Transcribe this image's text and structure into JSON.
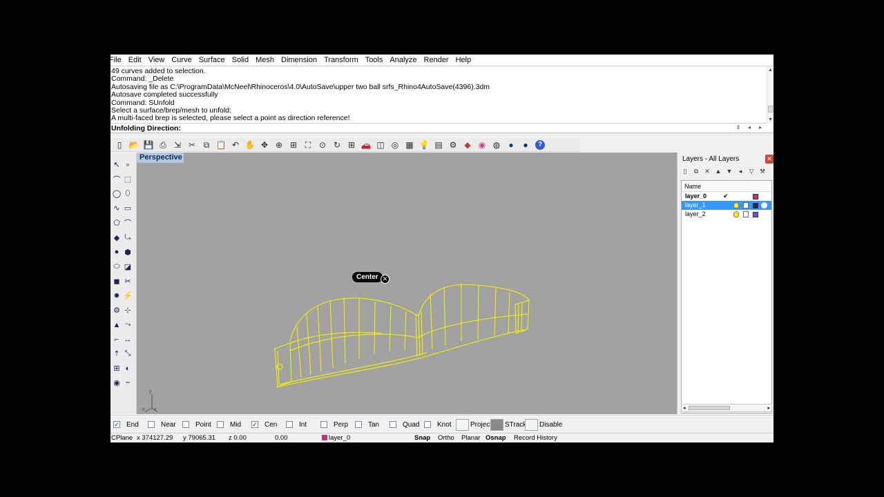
{
  "menu": [
    "File",
    "Edit",
    "View",
    "Curve",
    "Surface",
    "Solid",
    "Mesh",
    "Dimension",
    "Transform",
    "Tools",
    "Analyze",
    "Render",
    "Help"
  ],
  "command_history": [
    "49 curves added to selection.",
    "Command: _Delete",
    "Autosaving file as C:\\ProgramData\\McNeel\\Rhinoceros\\4.0\\AutoSave\\upper  two ball srfs_Rhino4AutoSave(4396).3dm",
    "Autosave completed successfully",
    "Command: SUnfold",
    "Select a surface/brep/mesh to unfold:",
    "A multi-faced brep is selected, please select a point as direction reference!"
  ],
  "command_prompt": "Unfolding Direction:",
  "viewport": {
    "title": "Perspective",
    "snap_tooltip": "Center",
    "background": "#a2a2a2",
    "wire_color": "#f2f200"
  },
  "toolbar_icons": [
    "new-file-icon",
    "open-icon",
    "save-icon",
    "print-icon",
    "import-icon",
    "cut-icon",
    "copy-icon",
    "paste-icon",
    "undo-icon",
    "pan-icon",
    "move-icon",
    "zoom-icon",
    "zoom-window-icon",
    "zoom-extents-icon",
    "zoom-selected-icon",
    "rotate-view-icon",
    "four-views-icon",
    "car-icon",
    "cplane-icon",
    "object-snap-icon",
    "grid-icon",
    "lightbulb-icon",
    "layer-icon",
    "properties-icon",
    "render-icon",
    "color-wheel-icon",
    "sphere-wire-icon",
    "sphere-shaded-icon",
    "sphere-render-icon",
    "help-icon"
  ],
  "layers": {
    "title": "Layers - All Layers",
    "column_name": "Name",
    "rows": [
      {
        "name": "layer_0",
        "current": true,
        "color": "#c0337a",
        "selected": false
      },
      {
        "name": "layer_1",
        "current": false,
        "color": "#1b2a66",
        "selected": true
      },
      {
        "name": "layer_2",
        "current": false,
        "color": "#6a4ee0",
        "selected": false
      }
    ]
  },
  "osnaps": [
    {
      "label": "End",
      "checked": true
    },
    {
      "label": "Near",
      "checked": false
    },
    {
      "label": "Point",
      "checked": false
    },
    {
      "label": "Mid",
      "checked": false
    },
    {
      "label": "Cen",
      "checked": true
    },
    {
      "label": "Int",
      "checked": false
    },
    {
      "label": "Perp",
      "checked": false
    },
    {
      "label": "Tan",
      "checked": false
    },
    {
      "label": "Quad",
      "checked": false
    },
    {
      "label": "Knot",
      "checked": false
    }
  ],
  "osnap_options": [
    "Project",
    "STrack",
    "Disable"
  ],
  "status": {
    "cplane": "CPlane",
    "x": "x 374127.29",
    "y": "y 79065.31",
    "z": "z 0.00",
    "d": "0.00",
    "layer": "layer_0",
    "layer_color": "#c0337a",
    "snap": "Snap",
    "ortho": "Ortho",
    "planar": "Planar",
    "osnap": "Osnap",
    "record": "Record History"
  }
}
